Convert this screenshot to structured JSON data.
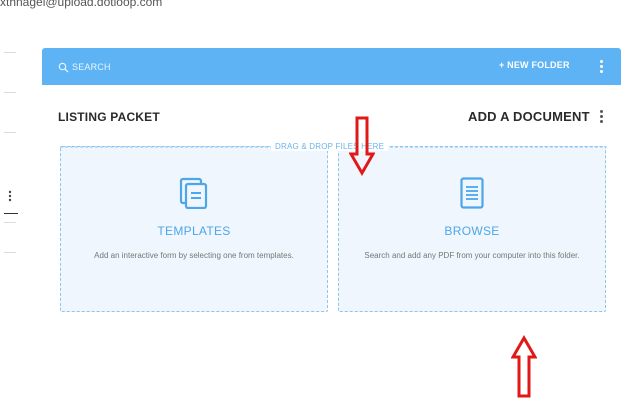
{
  "account": {
    "email": "xthnagel@upload.dotloop.com"
  },
  "toolbar": {
    "search_label": "SEARCH",
    "new_folder_label": "+ NEW FOLDER"
  },
  "header": {
    "packet_title": "LISTING PACKET",
    "add_document_label": "ADD A DOCUMENT"
  },
  "dropzone": {
    "label": "DRAG & DROP FILES HERE"
  },
  "cards": {
    "templates": {
      "title": "TEMPLATES",
      "description": "Add an interactive form by selecting one from templates.",
      "icon": "templates-icon"
    },
    "browse": {
      "title": "BROWSE",
      "description": "Search and add any PDF from your computer into this folder.",
      "icon": "document-icon"
    }
  },
  "annotations": {
    "arrow_color": "#e01818",
    "arrows": [
      "down-arrow",
      "up-arrow"
    ]
  },
  "colors": {
    "toolbar_bg": "#5eb3f5",
    "accent": "#4da6ea",
    "card_bg": "#eff6fd",
    "card_border": "#8ec4ee"
  }
}
